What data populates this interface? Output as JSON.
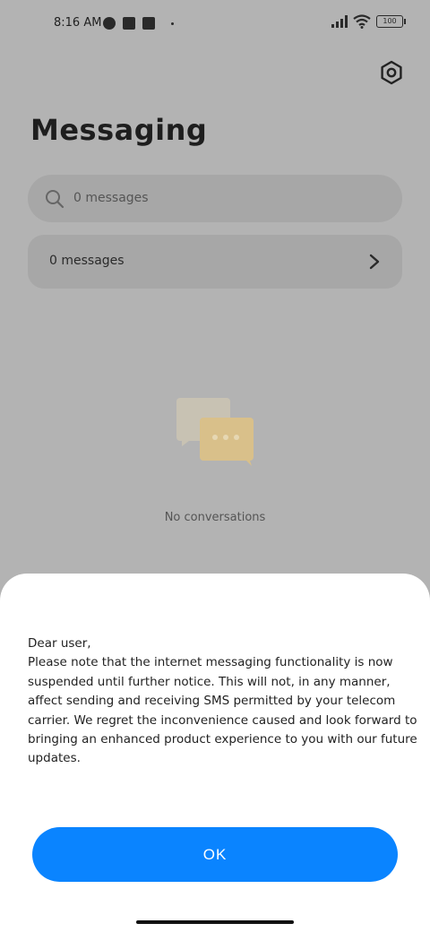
{
  "status_bar": {
    "time": "8:16 AM",
    "battery": "100",
    "icons": [
      "notification-app-icon",
      "square-app-icon",
      "upload-icon",
      "dot-icon",
      "signal-icon",
      "wifi-icon",
      "battery-icon"
    ]
  },
  "header": {
    "title": "Messaging",
    "settings_icon": "gear-icon"
  },
  "search": {
    "placeholder": "0 messages"
  },
  "message_row": {
    "label": "0 messages"
  },
  "empty_state": {
    "text": "No conversations",
    "icon": "chat-bubbles-illustration"
  },
  "dialog": {
    "greeting": "Dear user,",
    "body": "Please note that the internet messaging functionality is now suspended until further notice. This will not, in any manner, affect sending and receiving SMS permitted by your telecom carrier. We regret the inconvenience caused and look forward to bringing an enhanced product experience to you with our future updates.",
    "ok_label": "OK",
    "accent_color": "#0a84ff"
  }
}
